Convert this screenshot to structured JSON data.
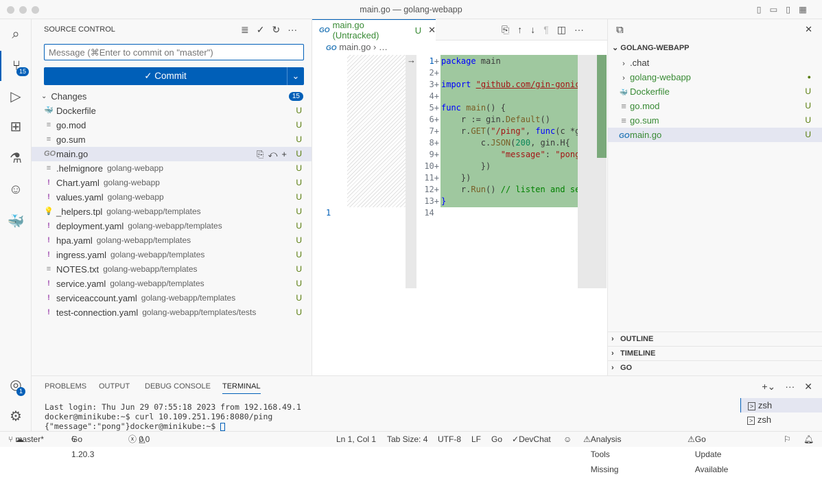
{
  "window": {
    "title": "main.go — golang-webapp"
  },
  "activity": {
    "scm_badge": "15",
    "accounts_badge": "1"
  },
  "scm": {
    "title": "SOURCE CONTROL",
    "message_placeholder": "Message (⌘Enter to commit on \"master\")",
    "commit_label": "✓ Commit",
    "changes_label": "Changes",
    "changes_count": "15",
    "files": [
      {
        "name": "Dockerfile",
        "dir": "",
        "status": "U",
        "icon": "docker-icon"
      },
      {
        "name": "go.mod",
        "dir": "",
        "status": "U",
        "icon": "file-lines-icon"
      },
      {
        "name": "go.sum",
        "dir": "",
        "status": "U",
        "icon": "file-lines-icon"
      },
      {
        "name": "main.go",
        "dir": "",
        "status": "U",
        "icon": "go-icon"
      },
      {
        "name": ".helmignore",
        "dir": "golang-webapp",
        "status": "U",
        "icon": "file-lines-icon"
      },
      {
        "name": "Chart.yaml",
        "dir": "golang-webapp",
        "status": "U",
        "icon": "yaml-icon"
      },
      {
        "name": "values.yaml",
        "dir": "golang-webapp",
        "status": "U",
        "icon": "yaml-icon"
      },
      {
        "name": "_helpers.tpl",
        "dir": "golang-webapp/templates",
        "status": "U",
        "icon": "bulb-icon"
      },
      {
        "name": "deployment.yaml",
        "dir": "golang-webapp/templates",
        "status": "U",
        "icon": "yaml-icon"
      },
      {
        "name": "hpa.yaml",
        "dir": "golang-webapp/templates",
        "status": "U",
        "icon": "yaml-icon"
      },
      {
        "name": "ingress.yaml",
        "dir": "golang-webapp/templates",
        "status": "U",
        "icon": "yaml-icon"
      },
      {
        "name": "NOTES.txt",
        "dir": "golang-webapp/templates",
        "status": "U",
        "icon": "file-lines-icon"
      },
      {
        "name": "service.yaml",
        "dir": "golang-webapp/templates",
        "status": "U",
        "icon": "yaml-icon"
      },
      {
        "name": "serviceaccount.yaml",
        "dir": "golang-webapp/templates",
        "status": "U",
        "icon": "yaml-icon"
      },
      {
        "name": "test-connection.yaml",
        "dir": "golang-webapp/templates/tests",
        "status": "U",
        "icon": "yaml-icon"
      }
    ]
  },
  "editor": {
    "tab": "main.go (Untracked)",
    "tab_status": "U",
    "breadcrumb": "main.go",
    "breadcrumb_more": "…",
    "left_line": "1",
    "lines": [
      "1",
      "2",
      "3",
      "4",
      "5",
      "6",
      "7",
      "8",
      "9",
      "10",
      "11",
      "12",
      "13",
      "14"
    ]
  },
  "explorer": {
    "root": "GOLANG-WEBAPP",
    "items": [
      {
        "name": ".chat",
        "folder": true,
        "status": ""
      },
      {
        "name": "golang-webapp",
        "folder": true,
        "status": "●"
      },
      {
        "name": "Dockerfile",
        "folder": false,
        "status": "U"
      },
      {
        "name": "go.mod",
        "folder": false,
        "status": "U"
      },
      {
        "name": "go.sum",
        "folder": false,
        "status": "U"
      },
      {
        "name": "main.go",
        "folder": false,
        "status": "U"
      }
    ],
    "sections": [
      "OUTLINE",
      "TIMELINE",
      "GO"
    ]
  },
  "panel": {
    "tabs": [
      "PROBLEMS",
      "OUTPUT",
      "DEBUG CONSOLE",
      "TERMINAL"
    ],
    "active": "TERMINAL",
    "terminal": [
      "Last login: Thu Jun 29 07:55:18 2023 from 192.168.49.1",
      "docker@minikube:~$ curl 10.109.251.196:8080/ping",
      "{\"message\":\"pong\"}docker@minikube:~$ "
    ],
    "shells": [
      "zsh",
      "zsh"
    ]
  },
  "status": {
    "branch": "master*",
    "go": "Go 1.20.3",
    "errors": "0",
    "warnings": "0",
    "position": "Ln 1, Col 1",
    "tab_size": "Tab Size: 4",
    "encoding": "UTF-8",
    "eol": "LF",
    "language": "Go",
    "devchat": "DevChat",
    "analysis": "Analysis Tools Missing",
    "update": "Go Update Available"
  },
  "colors": {
    "accent": "#005fb8",
    "added": "#587c0c",
    "diff_bg": "#9fc89f"
  }
}
